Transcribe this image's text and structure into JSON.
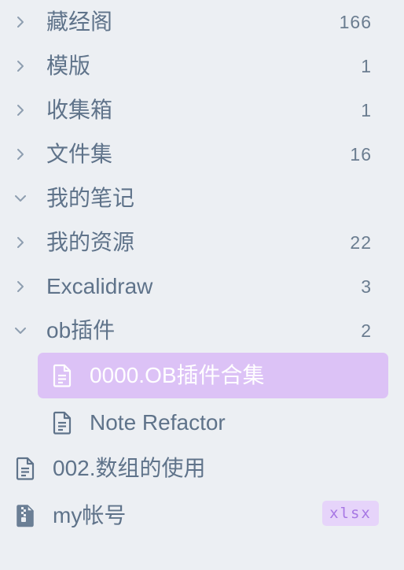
{
  "folders": [
    {
      "label": "藏经阁",
      "count": "166",
      "expanded": false
    },
    {
      "label": "模版",
      "count": "1",
      "expanded": false
    },
    {
      "label": "收集箱",
      "count": "1",
      "expanded": false
    },
    {
      "label": "文件集",
      "count": "16",
      "expanded": false
    },
    {
      "label": "我的笔记",
      "count": "",
      "expanded": true
    },
    {
      "label": "我的资源",
      "count": "22",
      "expanded": false
    },
    {
      "label": "Excalidraw",
      "count": "3",
      "expanded": false
    },
    {
      "label": "ob插件",
      "count": "2",
      "expanded": true
    }
  ],
  "ob_plugin_files": [
    {
      "label": "0000.OB插件合集",
      "active": true
    },
    {
      "label": "Note Refactor",
      "active": false
    }
  ],
  "root_files": [
    {
      "label": "002.数组的使用",
      "icon": "document-icon"
    },
    {
      "label": "my帐号",
      "icon": "archive-file-icon",
      "extension": "xlsx"
    }
  ],
  "colors": {
    "background": "#eceff3",
    "text": "#5f738a",
    "active_background": "#dcc2f6",
    "active_text": "#ffffff",
    "badge_background": "#e6d4fa",
    "badge_text": "#a777e4"
  }
}
